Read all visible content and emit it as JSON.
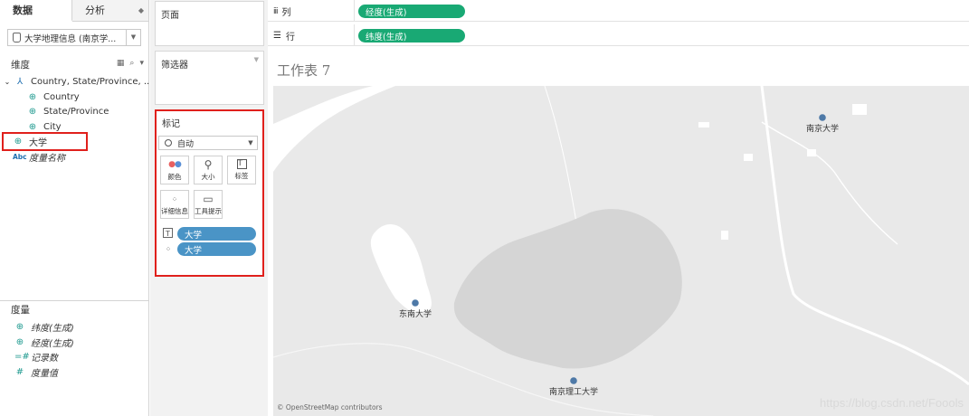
{
  "left_pane": {
    "tabs": [
      {
        "label": "数据"
      },
      {
        "label": "分析"
      }
    ],
    "datasource": "大学地理信息 (南京学...",
    "dimensions_title": "维度",
    "dimensions": [
      {
        "label": "Country, State/Province, ..."
      },
      {
        "label": "Country"
      },
      {
        "label": "State/Province"
      },
      {
        "label": "City"
      },
      {
        "label": "大学"
      },
      {
        "label": "度量名称",
        "abc": "Abc"
      }
    ],
    "measures_title": "度量",
    "measures": [
      {
        "label": "纬度(生成)"
      },
      {
        "label": "经度(生成)"
      },
      {
        "label": "记录数"
      },
      {
        "label": "度量值"
      }
    ]
  },
  "cards": {
    "pages": "页面",
    "filters": "筛选器",
    "marks": "标记",
    "mark_type": "自动",
    "buttons": [
      {
        "label": "颜色"
      },
      {
        "label": "大小"
      },
      {
        "label": "标签"
      },
      {
        "label": "详细信息"
      },
      {
        "label": "工具提示"
      }
    ],
    "mark_pills": [
      {
        "label": "大学"
      },
      {
        "label": "大学"
      }
    ]
  },
  "shelves": {
    "columns_label": "列",
    "columns_pill": "经度(生成)",
    "rows_label": "行",
    "rows_pill": "纬度(生成)"
  },
  "sheet": {
    "title": "工作表 7",
    "points": [
      {
        "label": "南京大学"
      },
      {
        "label": "东南大学"
      },
      {
        "label": "南京理工大学"
      }
    ],
    "attribution": "© OpenStreetMap contributors",
    "watermark": "https://blog.csdn.net/Foools"
  }
}
